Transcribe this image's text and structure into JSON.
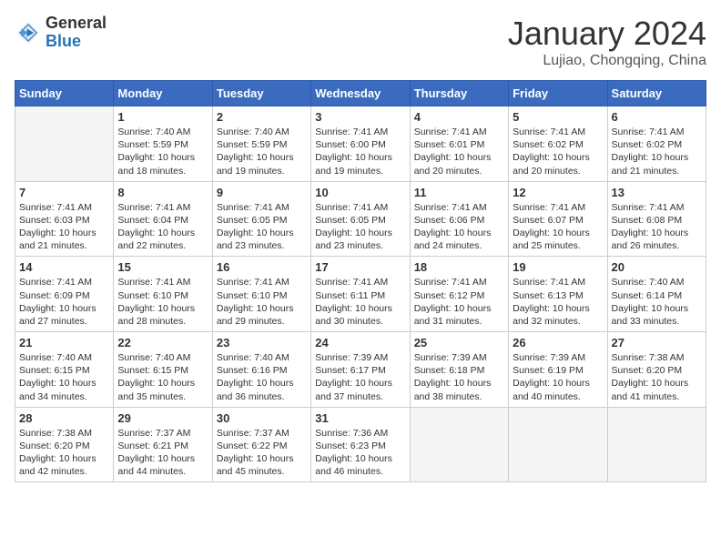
{
  "header": {
    "logo_general": "General",
    "logo_blue": "Blue",
    "month_title": "January 2024",
    "location": "Lujiao, Chongqing, China"
  },
  "days_of_week": [
    "Sunday",
    "Monday",
    "Tuesday",
    "Wednesday",
    "Thursday",
    "Friday",
    "Saturday"
  ],
  "weeks": [
    [
      {
        "day": "",
        "empty": true
      },
      {
        "day": "1",
        "sunrise": "Sunrise: 7:40 AM",
        "sunset": "Sunset: 5:59 PM",
        "daylight": "Daylight: 10 hours",
        "minutes": "and 18 minutes."
      },
      {
        "day": "2",
        "sunrise": "Sunrise: 7:40 AM",
        "sunset": "Sunset: 5:59 PM",
        "daylight": "Daylight: 10 hours",
        "minutes": "and 19 minutes."
      },
      {
        "day": "3",
        "sunrise": "Sunrise: 7:41 AM",
        "sunset": "Sunset: 6:00 PM",
        "daylight": "Daylight: 10 hours",
        "minutes": "and 19 minutes."
      },
      {
        "day": "4",
        "sunrise": "Sunrise: 7:41 AM",
        "sunset": "Sunset: 6:01 PM",
        "daylight": "Daylight: 10 hours",
        "minutes": "and 20 minutes."
      },
      {
        "day": "5",
        "sunrise": "Sunrise: 7:41 AM",
        "sunset": "Sunset: 6:02 PM",
        "daylight": "Daylight: 10 hours",
        "minutes": "and 20 minutes."
      },
      {
        "day": "6",
        "sunrise": "Sunrise: 7:41 AM",
        "sunset": "Sunset: 6:02 PM",
        "daylight": "Daylight: 10 hours",
        "minutes": "and 21 minutes."
      }
    ],
    [
      {
        "day": "7",
        "sunrise": "Sunrise: 7:41 AM",
        "sunset": "Sunset: 6:03 PM",
        "daylight": "Daylight: 10 hours",
        "minutes": "and 21 minutes."
      },
      {
        "day": "8",
        "sunrise": "Sunrise: 7:41 AM",
        "sunset": "Sunset: 6:04 PM",
        "daylight": "Daylight: 10 hours",
        "minutes": "and 22 minutes."
      },
      {
        "day": "9",
        "sunrise": "Sunrise: 7:41 AM",
        "sunset": "Sunset: 6:05 PM",
        "daylight": "Daylight: 10 hours",
        "minutes": "and 23 minutes."
      },
      {
        "day": "10",
        "sunrise": "Sunrise: 7:41 AM",
        "sunset": "Sunset: 6:05 PM",
        "daylight": "Daylight: 10 hours",
        "minutes": "and 23 minutes."
      },
      {
        "day": "11",
        "sunrise": "Sunrise: 7:41 AM",
        "sunset": "Sunset: 6:06 PM",
        "daylight": "Daylight: 10 hours",
        "minutes": "and 24 minutes."
      },
      {
        "day": "12",
        "sunrise": "Sunrise: 7:41 AM",
        "sunset": "Sunset: 6:07 PM",
        "daylight": "Daylight: 10 hours",
        "minutes": "and 25 minutes."
      },
      {
        "day": "13",
        "sunrise": "Sunrise: 7:41 AM",
        "sunset": "Sunset: 6:08 PM",
        "daylight": "Daylight: 10 hours",
        "minutes": "and 26 minutes."
      }
    ],
    [
      {
        "day": "14",
        "sunrise": "Sunrise: 7:41 AM",
        "sunset": "Sunset: 6:09 PM",
        "daylight": "Daylight: 10 hours",
        "minutes": "and 27 minutes."
      },
      {
        "day": "15",
        "sunrise": "Sunrise: 7:41 AM",
        "sunset": "Sunset: 6:10 PM",
        "daylight": "Daylight: 10 hours",
        "minutes": "and 28 minutes."
      },
      {
        "day": "16",
        "sunrise": "Sunrise: 7:41 AM",
        "sunset": "Sunset: 6:10 PM",
        "daylight": "Daylight: 10 hours",
        "minutes": "and 29 minutes."
      },
      {
        "day": "17",
        "sunrise": "Sunrise: 7:41 AM",
        "sunset": "Sunset: 6:11 PM",
        "daylight": "Daylight: 10 hours",
        "minutes": "and 30 minutes."
      },
      {
        "day": "18",
        "sunrise": "Sunrise: 7:41 AM",
        "sunset": "Sunset: 6:12 PM",
        "daylight": "Daylight: 10 hours",
        "minutes": "and 31 minutes."
      },
      {
        "day": "19",
        "sunrise": "Sunrise: 7:41 AM",
        "sunset": "Sunset: 6:13 PM",
        "daylight": "Daylight: 10 hours",
        "minutes": "and 32 minutes."
      },
      {
        "day": "20",
        "sunrise": "Sunrise: 7:40 AM",
        "sunset": "Sunset: 6:14 PM",
        "daylight": "Daylight: 10 hours",
        "minutes": "and 33 minutes."
      }
    ],
    [
      {
        "day": "21",
        "sunrise": "Sunrise: 7:40 AM",
        "sunset": "Sunset: 6:15 PM",
        "daylight": "Daylight: 10 hours",
        "minutes": "and 34 minutes."
      },
      {
        "day": "22",
        "sunrise": "Sunrise: 7:40 AM",
        "sunset": "Sunset: 6:15 PM",
        "daylight": "Daylight: 10 hours",
        "minutes": "and 35 minutes."
      },
      {
        "day": "23",
        "sunrise": "Sunrise: 7:40 AM",
        "sunset": "Sunset: 6:16 PM",
        "daylight": "Daylight: 10 hours",
        "minutes": "and 36 minutes."
      },
      {
        "day": "24",
        "sunrise": "Sunrise: 7:39 AM",
        "sunset": "Sunset: 6:17 PM",
        "daylight": "Daylight: 10 hours",
        "minutes": "and 37 minutes."
      },
      {
        "day": "25",
        "sunrise": "Sunrise: 7:39 AM",
        "sunset": "Sunset: 6:18 PM",
        "daylight": "Daylight: 10 hours",
        "minutes": "and 38 minutes."
      },
      {
        "day": "26",
        "sunrise": "Sunrise: 7:39 AM",
        "sunset": "Sunset: 6:19 PM",
        "daylight": "Daylight: 10 hours",
        "minutes": "and 40 minutes."
      },
      {
        "day": "27",
        "sunrise": "Sunrise: 7:38 AM",
        "sunset": "Sunset: 6:20 PM",
        "daylight": "Daylight: 10 hours",
        "minutes": "and 41 minutes."
      }
    ],
    [
      {
        "day": "28",
        "sunrise": "Sunrise: 7:38 AM",
        "sunset": "Sunset: 6:20 PM",
        "daylight": "Daylight: 10 hours",
        "minutes": "and 42 minutes."
      },
      {
        "day": "29",
        "sunrise": "Sunrise: 7:37 AM",
        "sunset": "Sunset: 6:21 PM",
        "daylight": "Daylight: 10 hours",
        "minutes": "and 44 minutes."
      },
      {
        "day": "30",
        "sunrise": "Sunrise: 7:37 AM",
        "sunset": "Sunset: 6:22 PM",
        "daylight": "Daylight: 10 hours",
        "minutes": "and 45 minutes."
      },
      {
        "day": "31",
        "sunrise": "Sunrise: 7:36 AM",
        "sunset": "Sunset: 6:23 PM",
        "daylight": "Daylight: 10 hours",
        "minutes": "and 46 minutes."
      },
      {
        "day": "",
        "empty": true
      },
      {
        "day": "",
        "empty": true
      },
      {
        "day": "",
        "empty": true
      }
    ]
  ]
}
